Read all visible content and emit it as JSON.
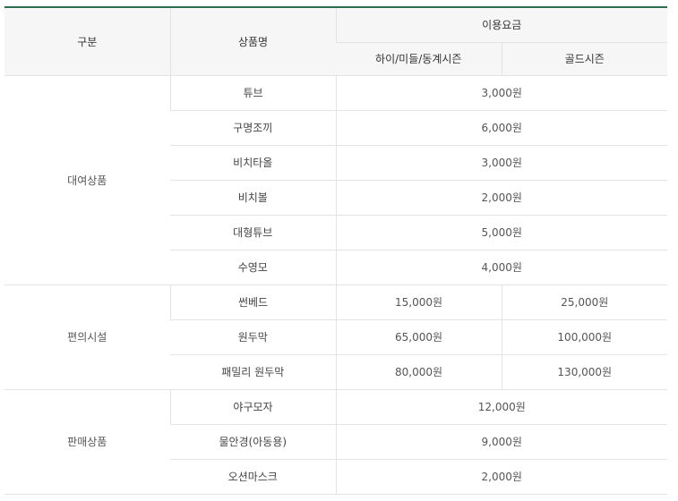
{
  "header": {
    "category": "구분",
    "product": "상품명",
    "fee": "이용요금",
    "season_normal": "하이/미들/동계시즌",
    "season_gold": "골드시즌"
  },
  "groups": [
    {
      "name": "대여상품",
      "rows": [
        {
          "product": "튜브",
          "price": "3,000원"
        },
        {
          "product": "구명조끼",
          "price": "6,000원"
        },
        {
          "product": "비치타올",
          "price": "3,000원"
        },
        {
          "product": "비치볼",
          "price": "2,000원"
        },
        {
          "product": "대형튜브",
          "price": "5,000원"
        },
        {
          "product": "수영모",
          "price": "4,000원"
        }
      ]
    },
    {
      "name": "편의시설",
      "rows": [
        {
          "product": "썬베드",
          "normal": "15,000원",
          "gold": "25,000원"
        },
        {
          "product": "원두막",
          "normal": "65,000원",
          "gold": "100,000원"
        },
        {
          "product": "패밀리 원두막",
          "normal": "80,000원",
          "gold": "130,000원"
        }
      ]
    },
    {
      "name": "판매상품",
      "rows": [
        {
          "product": "야구모자",
          "price": "12,000원"
        },
        {
          "product": "물안경(아동용)",
          "price": "9,000원"
        },
        {
          "product": "오션마스크",
          "price": "2,000원"
        }
      ]
    }
  ]
}
